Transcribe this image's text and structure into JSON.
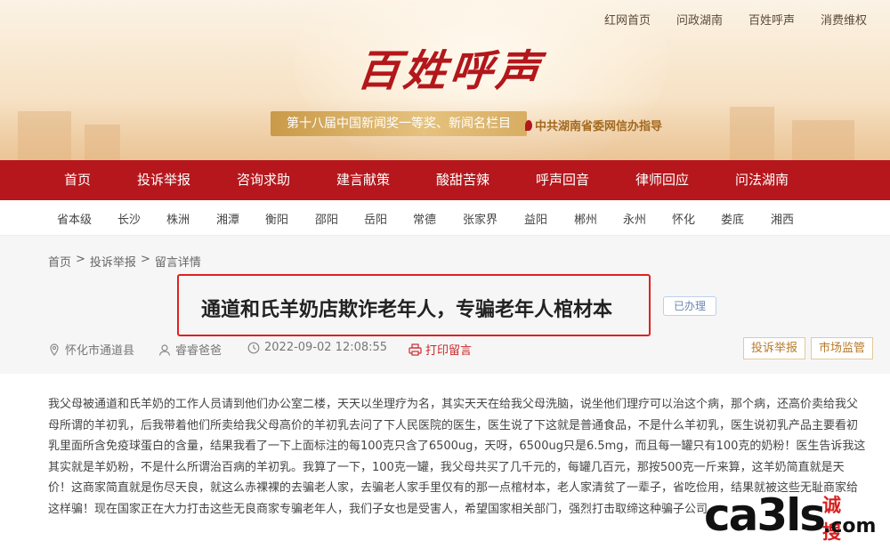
{
  "header": {
    "top_links": [
      "红网首页",
      "问政湖南",
      "百姓呼声",
      "消费维权"
    ],
    "logo_title": "百姓呼声",
    "award": "第十八届中国新闻奖一等奖、新闻名栏目",
    "guide": "中共湖南省委网信办指导"
  },
  "main_nav": [
    "首页",
    "投诉举报",
    "咨询求助",
    "建言献策",
    "酸甜苦辣",
    "呼声回音",
    "律师回应",
    "问法湖南"
  ],
  "sub_nav": [
    "省本级",
    "长沙",
    "株洲",
    "湘潭",
    "衡阳",
    "邵阳",
    "岳阳",
    "常德",
    "张家界",
    "益阳",
    "郴州",
    "永州",
    "怀化",
    "娄底",
    "湘西"
  ],
  "breadcrumb": [
    "首页",
    "投诉举报",
    "留言详情"
  ],
  "breadcrumb_sep": ">",
  "post": {
    "title": "通道和氏羊奶店欺诈老年人，专骗老年人棺材本",
    "status": "已办理",
    "location": "怀化市通道县",
    "author": "睿睿爸爸",
    "datetime": "2022-09-02 12:08:55",
    "print": "打印留言",
    "tags": [
      "投诉举报",
      "市场监管"
    ],
    "body": "我父母被通道和氏羊奶的工作人员请到他们办公室二楼，天天以坐理疗为名，其实天天在给我父母洗脑，说坐他们理疗可以治这个病，那个病，还高价卖给我父母所谓的羊初乳，后我带着他们所卖给我父母高价的羊初乳去问了下人民医院的医生，医生说了下这就是普通食品，不是什么羊初乳，医生说初乳产品主要看初乳里面所含免疫球蛋白的含量，结果我看了一下上面标注的每100克只含了6500ug，天呀，6500ug只是6.5mg，而且每一罐只有100克的奶粉！医生告诉我这其实就是羊奶粉，不是什么所谓治百病的羊初乳。我算了一下，100克一罐，我父母共买了几千元的，每罐几百元，那按500克一斤来算，这羊奶简直就是天价！这商家简直就是伤尽天良，就这么赤裸裸的去骗老人家，去骗老人家手里仅有的那一点棺材本，老人家清贫了一辈子，省吃俭用，结果就被这些无耻商家给这样骗！现在国家正在大力打击这些无良商家专骗老年人，我们子女也是受害人，希望国家相关部门，强烈打击取缔这种骗子公司。"
  },
  "watermark": {
    "main": "ca3ls",
    "cn": "诚搜",
    "com": ".com"
  },
  "colors": {
    "nav_red": "#b5171c",
    "highlight_border": "#e02020",
    "tag_border": "#e6c89b",
    "print_red": "#c9292d"
  }
}
